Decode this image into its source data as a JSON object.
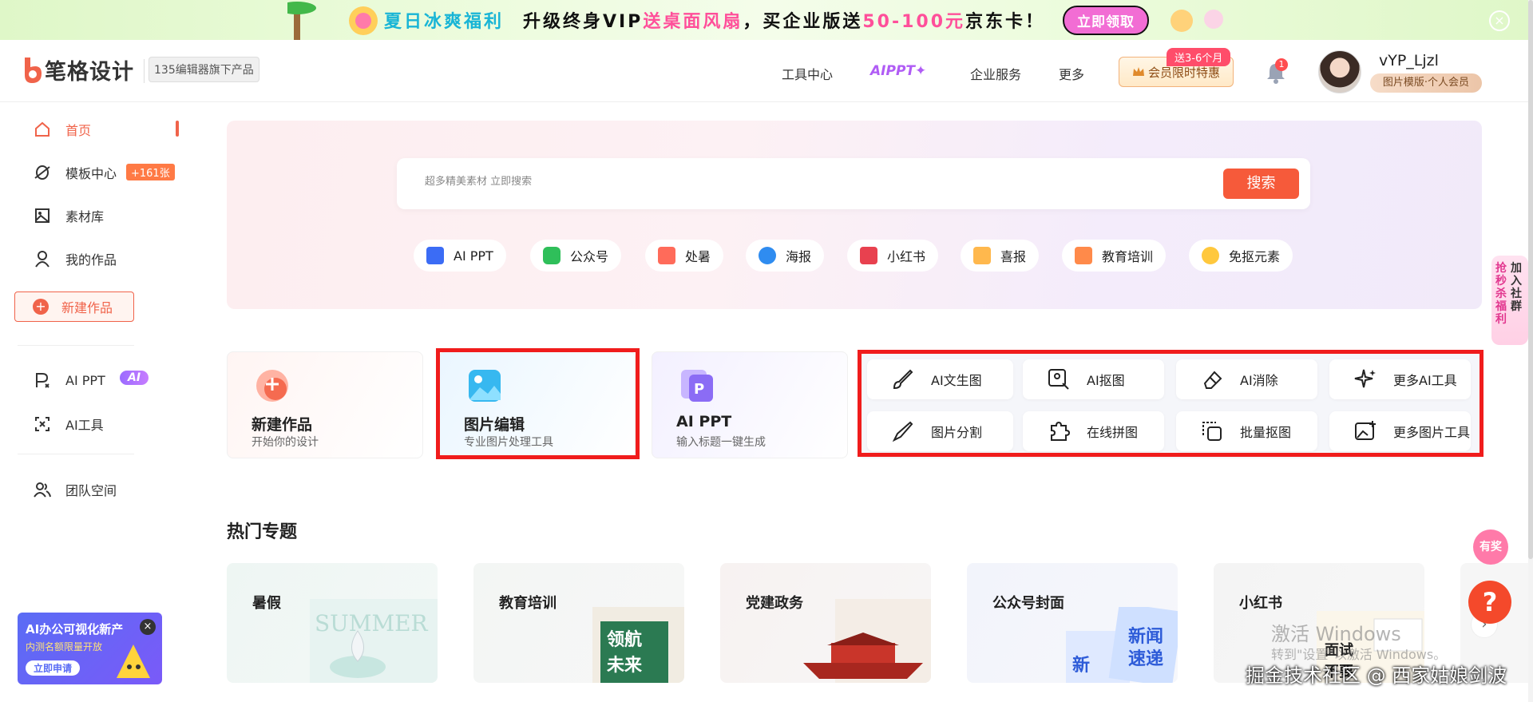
{
  "promo": {
    "part1": "夏日冰爽福利",
    "part2": "升级终身VIP",
    "part3": "送桌面风扇",
    "part4": "，买企业版送",
    "part5": "50-100元",
    "part6": "京东卡！",
    "button": "立即领取",
    "close": "×"
  },
  "header": {
    "logo": "笔格设计",
    "sub_brand": "135编辑器旗下产品",
    "nav": [
      "工具中心",
      "AIPPT✦",
      "企业服务",
      "更多"
    ],
    "vip_button": "会员限时特惠",
    "vip_tag": "送3-6个月",
    "notification_count": "1",
    "username": "vYP_Ljzl",
    "member_badge": "图片模版·个人会员"
  },
  "sidebar": {
    "items": [
      {
        "label": "首页",
        "icon": "home-icon"
      },
      {
        "label": "模板中心",
        "icon": "template-icon"
      },
      {
        "label": "素材库",
        "icon": "image-icon"
      },
      {
        "label": "我的作品",
        "icon": "user-icon"
      }
    ],
    "template_badge": "+161张",
    "new_button": "新建作品",
    "ai_ppt": "AI PPT",
    "ai_badge": "AI",
    "ai_tools": "AI工具",
    "team": "团队空间"
  },
  "promo_card": {
    "title": "AI办公可视化新产",
    "subtitle": "内测名额限量开放",
    "button": "立即申请",
    "close": "×"
  },
  "search": {
    "placeholder": "超多精美素材 立即搜索",
    "button": "搜索"
  },
  "tags": [
    "AI PPT",
    "公众号",
    "处暑",
    "海报",
    "小红书",
    "喜报",
    "教育培训",
    "免抠元素"
  ],
  "cards": [
    {
      "title": "新建作品",
      "desc": "开始你的设计"
    },
    {
      "title": "图片编辑",
      "desc": "专业图片处理工具"
    },
    {
      "title": "AI PPT",
      "desc": "输入标题一键生成"
    }
  ],
  "tools": [
    "AI文生图",
    "AI抠图",
    "AI消除",
    "更多AI工具",
    "图片分割",
    "在线拼图",
    "批量抠图",
    "更多图片工具"
  ],
  "section_title": "热门专题",
  "topics": [
    "暑假",
    "教育培训",
    "党建政务",
    "公众号封面",
    "小红书"
  ],
  "right_float": {
    "line1": "抢秒杀福利",
    "line2": "加入社群"
  },
  "kefu": "有奖",
  "help": "?",
  "windows": {
    "line1": "激活 Windows",
    "line2": "转到\"设置\"以激活 Windows。"
  },
  "watermark": "掘金技术社区 @ 西家姑娘剑波"
}
